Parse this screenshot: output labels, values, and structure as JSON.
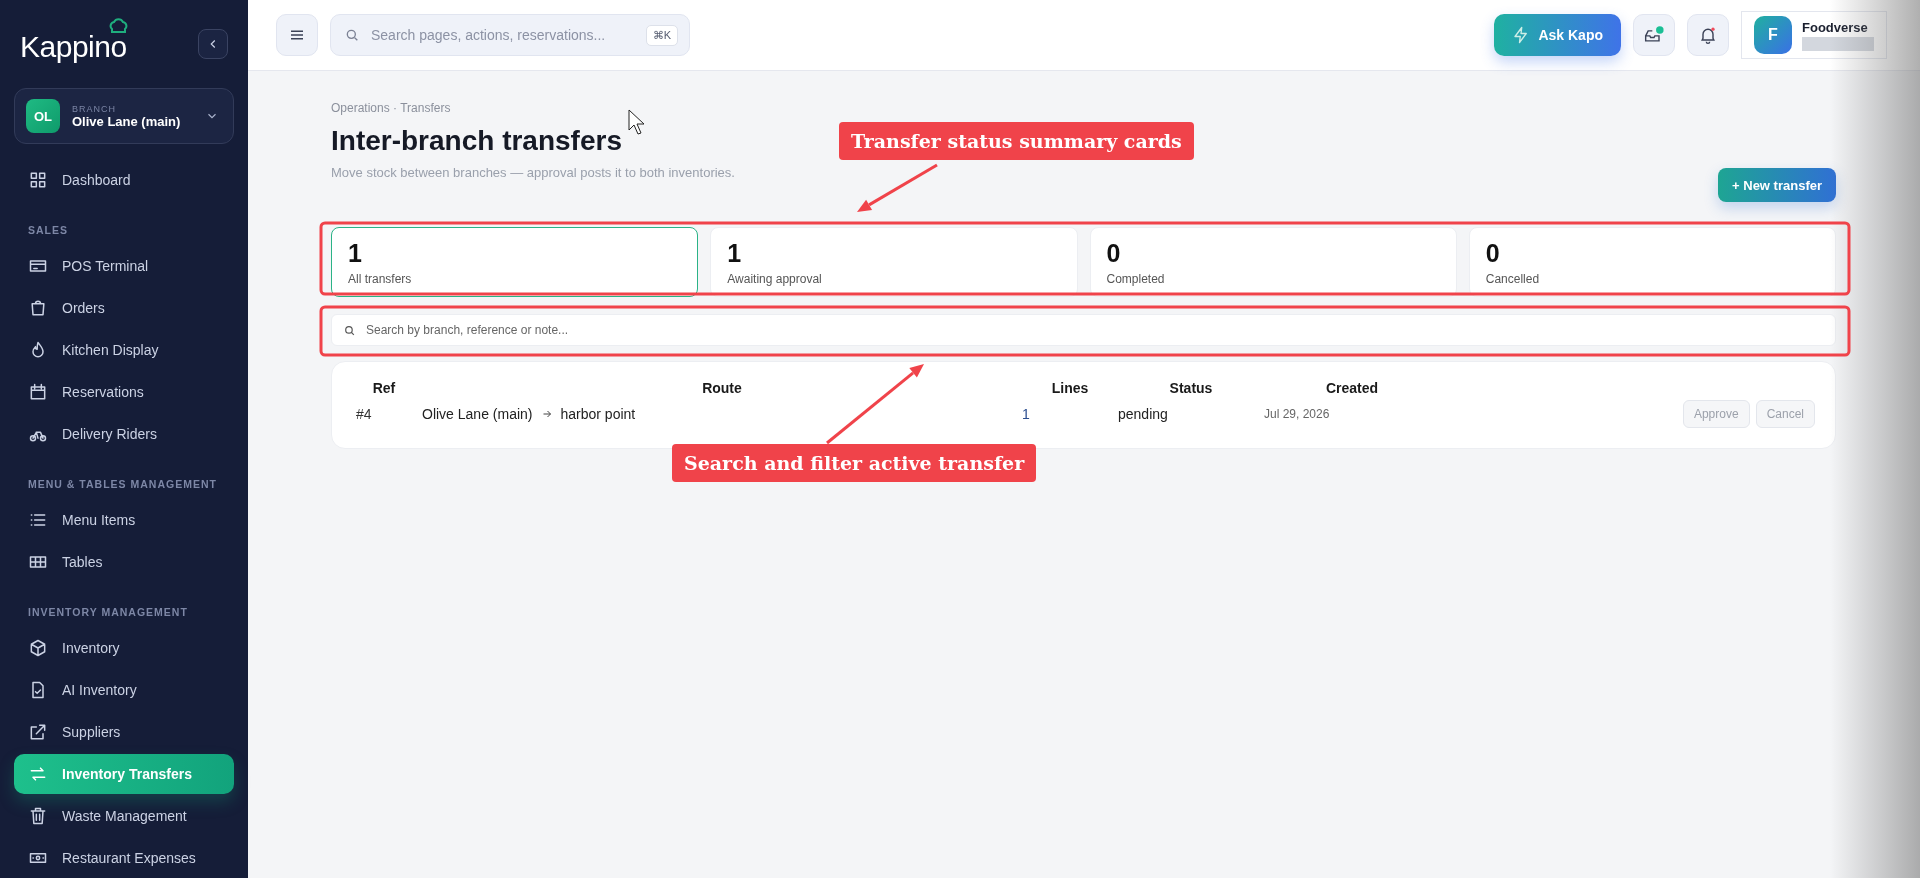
{
  "sidebar": {
    "logo": "Kappino",
    "branch": {
      "initials": "OL",
      "label": "BRANCH",
      "name": "Olive Lane (main)"
    },
    "sections": [
      {
        "items": [
          {
            "label": "Dashboard",
            "selected": false
          }
        ]
      },
      {
        "heading": "SALES",
        "items": [
          {
            "label": "POS Terminal",
            "selected": false
          },
          {
            "label": "Orders",
            "selected": false
          },
          {
            "label": "Kitchen Display",
            "selected": false
          },
          {
            "label": "Reservations",
            "selected": false
          },
          {
            "label": "Delivery Riders",
            "selected": false
          }
        ]
      },
      {
        "heading": "MENU & TABLES MANAGEMENT",
        "items": [
          {
            "label": "Menu Items",
            "selected": false
          },
          {
            "label": "Tables",
            "selected": false
          }
        ]
      },
      {
        "heading": "INVENTORY MANAGEMENT",
        "items": [
          {
            "label": "Inventory",
            "selected": false
          },
          {
            "label": "AI Inventory",
            "selected": false
          },
          {
            "label": "Suppliers",
            "selected": false
          },
          {
            "label": "Inventory Transfers",
            "selected": true
          },
          {
            "label": "Waste Management",
            "selected": false
          },
          {
            "label": "Restaurant Expenses",
            "selected": false
          }
        ]
      }
    ]
  },
  "topbar": {
    "search": {
      "placeholder": "Search pages, actions, reservations...",
      "shortcut": "⌘K"
    },
    "ask_button": "Ask Kapo",
    "user": {
      "initial": "F",
      "name": "Foodverse"
    }
  },
  "page": {
    "breadcrumb": "Operations · Transfers",
    "title": "Inter-branch transfers",
    "subtitle": "Move stock between branches — approval posts it to both inventories.",
    "new_button": "+ New transfer"
  },
  "cards": [
    {
      "count": "1",
      "label": "All transfers",
      "selected": true
    },
    {
      "count": "1",
      "label": "Awaiting approval",
      "selected": false
    },
    {
      "count": "0",
      "label": "Completed",
      "selected": false
    },
    {
      "count": "0",
      "label": "Cancelled",
      "selected": false
    }
  ],
  "filter": {
    "placeholder": "Search by branch, reference or note..."
  },
  "table": {
    "columns": [
      "Ref",
      "Route",
      "Lines",
      "Status",
      "Created"
    ],
    "rows": [
      {
        "ref": "#4",
        "from": "Olive Lane (main)",
        "to": "harbor point",
        "lines": "1",
        "status": "pending",
        "created": "Jul 29, 2026",
        "actions": [
          {
            "label": "Approve",
            "disabled": true
          },
          {
            "label": "Cancel",
            "disabled": true
          }
        ]
      }
    ]
  },
  "annotations": [
    {
      "kind": "callout",
      "text": "Transfer status summary cards"
    },
    {
      "kind": "callout",
      "text": "Search and filter active transfer"
    }
  ]
}
